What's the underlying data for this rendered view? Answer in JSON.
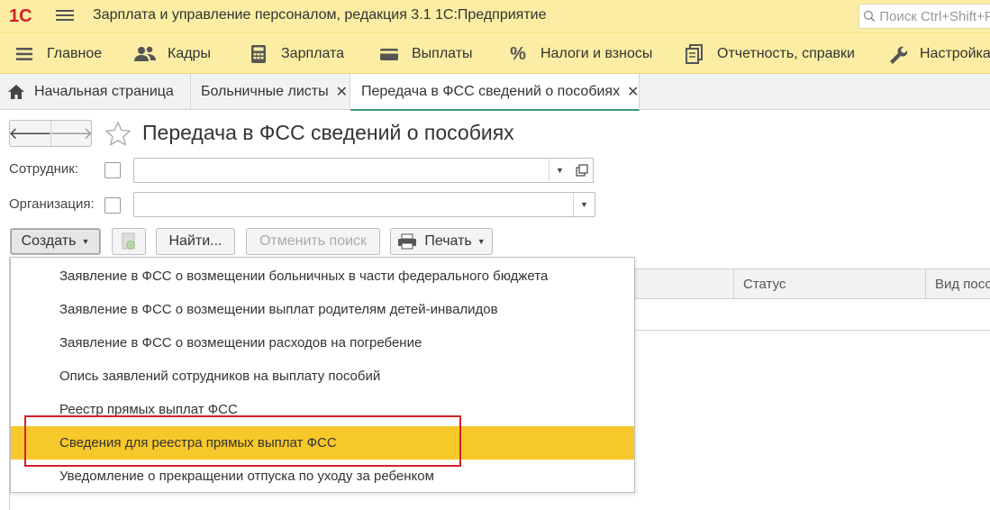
{
  "app": {
    "logo_text": "1С",
    "title": "Зарплата и управление персоналом, редакция 3.1 1С:Предприятие",
    "search_placeholder": "Поиск Ctrl+Shift+F"
  },
  "sections": [
    {
      "label": "Главное",
      "icon": "menu-lines-icon"
    },
    {
      "label": "Кадры",
      "icon": "people-icon"
    },
    {
      "label": "Зарплата",
      "icon": "calculator-icon"
    },
    {
      "label": "Выплаты",
      "icon": "wallet-icon"
    },
    {
      "label": "Налоги и взносы",
      "icon": "percent-icon"
    },
    {
      "label": "Отчетность, справки",
      "icon": "documents-icon"
    },
    {
      "label": "Настройка",
      "icon": "wrench-icon"
    }
  ],
  "tabs": [
    {
      "label": "Начальная страница",
      "icon": "home-icon"
    },
    {
      "label": "Больничные листы",
      "close": "✕"
    },
    {
      "label": "Передача в ФСС сведений о пособиях",
      "close": "✕",
      "active": true
    }
  ],
  "form": {
    "title": "Передача в ФСС сведений о пособиях",
    "employee_label": "Сотрудник:",
    "employee_value": "",
    "organization_label": "Организация:",
    "organization_value": ""
  },
  "toolbar": {
    "create_label": "Создать",
    "find_label": "Найти...",
    "cancel_search_label": "Отменить поиск",
    "print_label": "Печать"
  },
  "table": {
    "columns": [
      "Статус",
      "Вид посо"
    ]
  },
  "create_menu": {
    "items": [
      "Заявление в ФСС о возмещении больничных в части федерального бюджета",
      "Заявление в ФСС о возмещении выплат родителям детей-инвалидов",
      "Заявление в ФСС о возмещении расходов на погребение",
      "Опись заявлений сотрудников на выплату пособий",
      "Реестр прямых выплат ФСС",
      "Сведения для реестра прямых выплат ФСС",
      "Уведомление о прекращении отпуска по уходу за ребенком"
    ],
    "highlighted_index": 5
  },
  "colors": {
    "header_bg": "#fbeda3",
    "highlight": "#f7c82a",
    "annotation": "#d3202a",
    "logo_red": "#d3202a"
  }
}
